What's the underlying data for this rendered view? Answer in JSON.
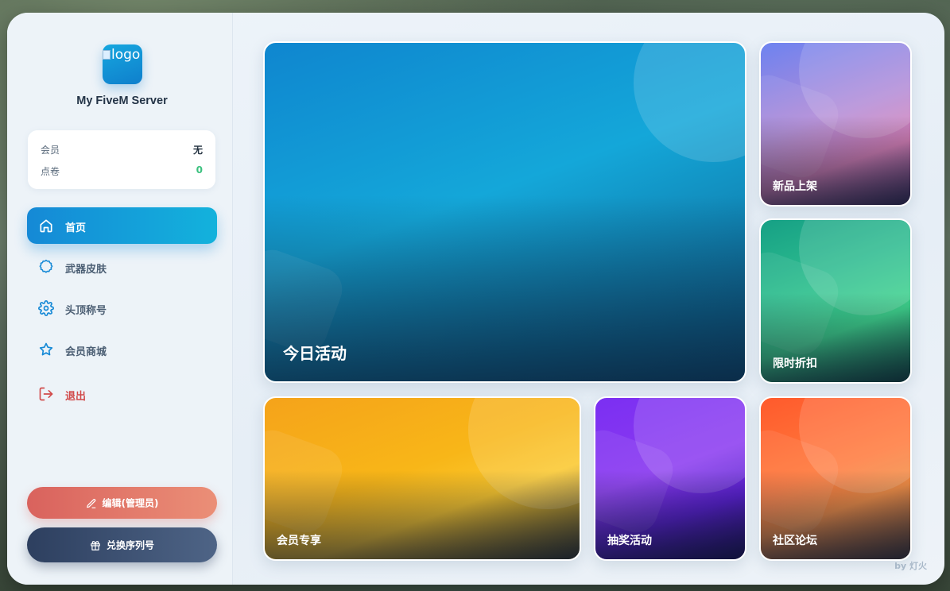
{
  "app": {
    "logo_alt": "logo",
    "server_name": "My FiveM Server",
    "footer": "by 灯火"
  },
  "stats": {
    "membership_label": "会员",
    "membership_value": "无",
    "points_label": "点卷",
    "points_value": "0"
  },
  "nav": [
    {
      "label": "首页",
      "icon": "home-icon",
      "active": true
    },
    {
      "label": "武器皮肤",
      "icon": "gear-badge-icon"
    },
    {
      "label": "头顶称号",
      "icon": "settings-icon"
    },
    {
      "label": "会员商城",
      "icon": "star-icon"
    },
    {
      "label": "退出",
      "icon": "logout-icon"
    }
  ],
  "buttons": {
    "edit": "编辑(管理员)",
    "redeem": "兑换序列号"
  },
  "tiles": {
    "today": "今日活动",
    "new_items": "新品上架",
    "discount": "限时折扣",
    "vip": "会员专享",
    "lottery": "抽奖活动",
    "forum": "社区论坛"
  },
  "colors": {
    "accent": "#1589d6",
    "points_green": "#3cc17f",
    "logout_red": "#d14b4b"
  }
}
